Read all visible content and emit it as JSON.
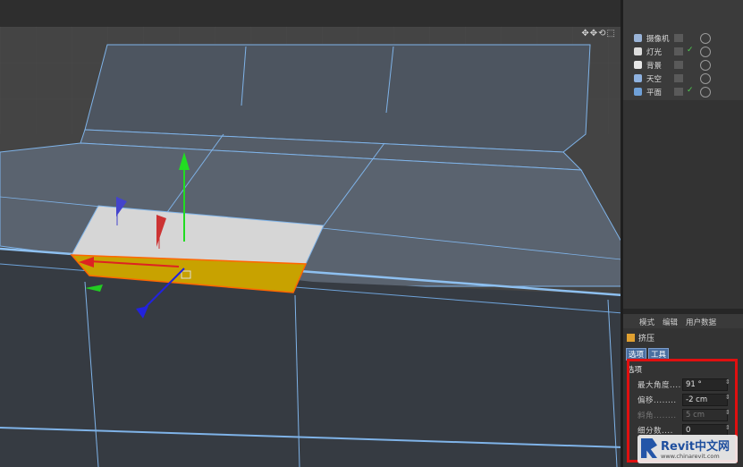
{
  "viewport": {
    "tool_icons": "✥✥⟲⬚"
  },
  "object_manager": {
    "items": [
      {
        "label": "摄像机",
        "icon_color": "#9ab4d8",
        "icon": "camera-icon"
      },
      {
        "label": "灯光",
        "icon_color": "#dddddd",
        "icon": "light-icon"
      },
      {
        "label": "背景",
        "icon_color": "#e7e7e7",
        "icon": "background-icon"
      },
      {
        "label": "天空",
        "icon_color": "#8fb2e0",
        "icon": "sky-icon"
      },
      {
        "label": "平面",
        "icon_color": "#6fa0d8",
        "icon": "plane-icon"
      }
    ]
  },
  "attributes": {
    "tabs": [
      "模式",
      "编辑",
      "用户数据"
    ],
    "title": "挤压",
    "sub_tabs": [
      "选项",
      "工具"
    ],
    "section": "选项",
    "params": [
      {
        "label": "最大角度",
        "dots": "....",
        "value": "91 °"
      },
      {
        "label": "偏移",
        "dots": "........",
        "value": "-2 cm"
      },
      {
        "label": "斜角",
        "dots": "........",
        "value": "5 cm"
      },
      {
        "label": "细分数",
        "dots": "....",
        "value": "0"
      }
    ]
  },
  "watermark": {
    "brand": "Revit中文网",
    "url": "www.chinarevit.com"
  }
}
